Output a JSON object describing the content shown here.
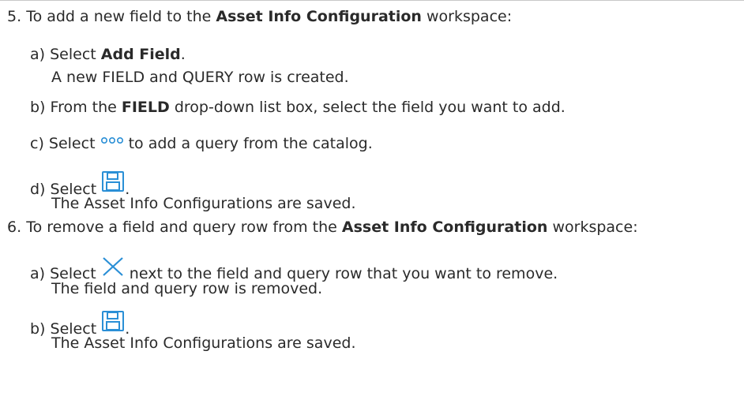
{
  "steps": [
    {
      "number": "5.",
      "text_before": "To add a new field to the ",
      "bold": "Asset Info Configuration",
      "text_after": " workspace:",
      "substeps": [
        {
          "letter": "a)",
          "text_before": "Select ",
          "bold": "Add Field",
          "text_after": ".",
          "result": "A new FIELD and QUERY row is created."
        },
        {
          "letter": "b)",
          "text_before": "From the ",
          "bold": "FIELD",
          "text_after": " drop-down list box, select the field you want to add."
        },
        {
          "letter": "c)",
          "text_before": "Select ",
          "icon": "ellipsis-icon",
          "text_after": " to add a query from the catalog."
        },
        {
          "letter": "d)",
          "text_before": "Select ",
          "icon": "save-icon",
          "text_after": ".",
          "result": "The Asset Info Configurations are saved."
        }
      ]
    },
    {
      "number": "6.",
      "text_before": "To remove a field and query row from the ",
      "bold": "Asset Info Configuration",
      "text_after": " workspace:",
      "substeps": [
        {
          "letter": "a)",
          "text_before": "Select ",
          "icon": "close-icon",
          "text_after": " next to the field and query row that you want to remove.",
          "result": "The field and query row is removed."
        },
        {
          "letter": "b)",
          "text_before": "Select ",
          "icon": "save-icon",
          "text_after": ".",
          "result": "The Asset Info Configurations are saved."
        }
      ]
    }
  ],
  "colors": {
    "icon_blue": "#2a8fd6",
    "text": "#2a2a2a"
  }
}
